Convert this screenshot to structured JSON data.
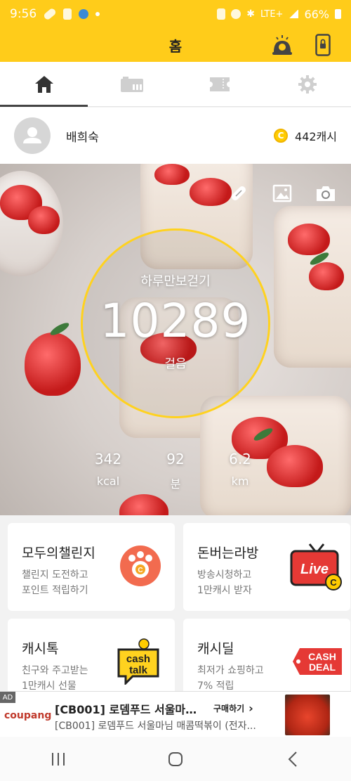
{
  "status_bar": {
    "time": "9:56",
    "network": "LTE+",
    "battery": "66%"
  },
  "app_bar": {
    "title": "홈"
  },
  "tabs": [
    {
      "name": "home",
      "icon": "home-icon"
    },
    {
      "name": "store",
      "icon": "store-icon"
    },
    {
      "name": "ticket",
      "icon": "ticket-icon"
    },
    {
      "name": "settings",
      "icon": "gear-icon"
    }
  ],
  "profile": {
    "name": "배희숙",
    "cash": "442캐시"
  },
  "hero": {
    "title": "하루만보걷기",
    "steps": "10289",
    "steps_unit": "걸음",
    "stats": [
      {
        "value": "342",
        "unit": "kcal"
      },
      {
        "value": "92",
        "unit": "분"
      },
      {
        "value": "6.2",
        "unit": "km"
      }
    ]
  },
  "cards": [
    {
      "title": "모두의챌린지",
      "sub1": "챌린지 도전하고",
      "sub2": "포인트 적립하기"
    },
    {
      "title": "돈버는라방",
      "sub1": "방송시청하고",
      "sub2": "1만캐시 받자",
      "art_text": "Live"
    },
    {
      "title": "캐시톡",
      "sub1": "친구와 주고받는",
      "sub2": "1만캐시 선물",
      "art_text_1": "cash",
      "art_text_2": "talk"
    },
    {
      "title": "캐시딜",
      "sub1": "최저가 쇼핑하고",
      "sub2": "7% 적립",
      "art_text_1": "CASH",
      "art_text_2": "DEAL"
    }
  ],
  "ad": {
    "badge": "AD",
    "brand": "coupang",
    "title": "[CB001] 로뎀푸드 서울마님 ...",
    "cta": "구매하기",
    "description": "[CB001] 로뎀푸드 서울마님 매콤떡볶이 (전자..."
  },
  "colors": {
    "accent": "#ffcc1a",
    "ring": "#ffd21f",
    "live_red": "#e53935",
    "challenge_orange": "#f26b4f"
  }
}
